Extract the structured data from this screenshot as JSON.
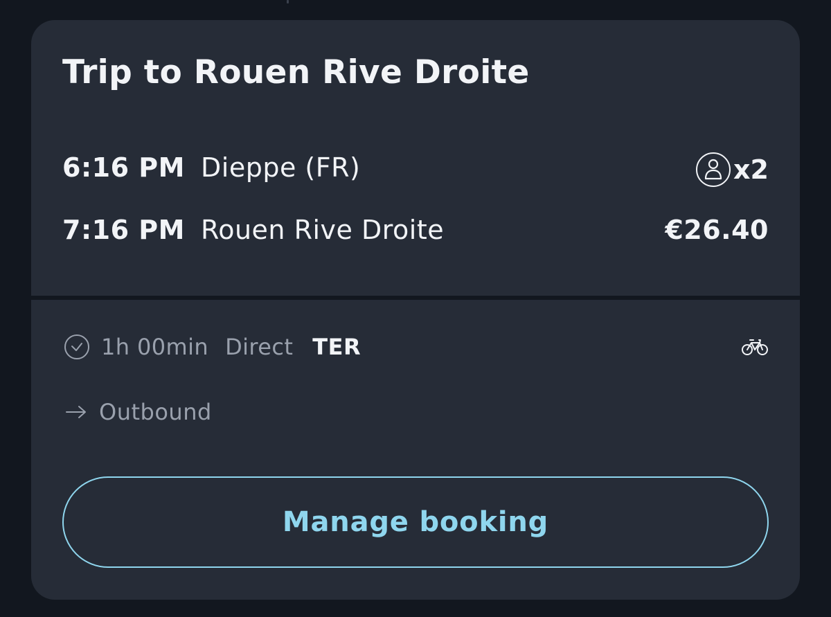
{
  "trip": {
    "title": "Trip to Rouen Rive Droite",
    "departure": {
      "time": "6:16 PM",
      "station": "Dieppe (FR)"
    },
    "arrival": {
      "time": "7:16 PM",
      "station": "Rouen Rive Droite"
    },
    "passengers": {
      "count_label": "x2",
      "icon": "person-icon"
    },
    "price": "€26.40"
  },
  "details": {
    "duration": "1h 00min",
    "connection": "Direct",
    "train_type": "TER",
    "duration_icon": "clock-icon",
    "amenity_icon": "bicycle-icon"
  },
  "direction": {
    "label": "Outbound",
    "icon": "arrow-right-icon"
  },
  "actions": {
    "manage_booking_label": "Manage booking"
  },
  "colors": {
    "background": "#12171f",
    "card": "#262c37",
    "text_primary": "#f2f4f7",
    "text_secondary": "#9aa1ad",
    "accent": "#8fd6ee"
  }
}
